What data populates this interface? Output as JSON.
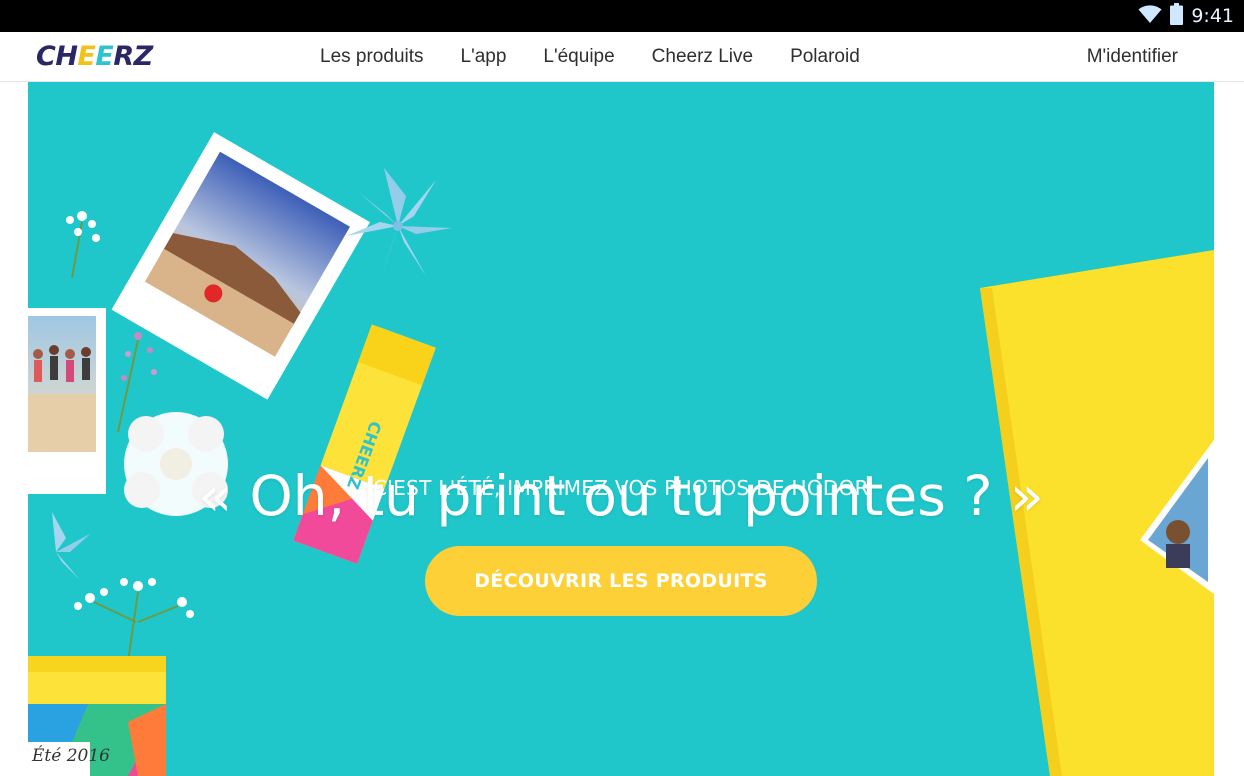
{
  "status_bar": {
    "time": "9:41",
    "icons": [
      "wifi-icon",
      "battery-icon"
    ]
  },
  "nav": {
    "logo_parts": [
      "CH",
      "E",
      "E",
      "RZ"
    ],
    "links": [
      "Les produits",
      "L'app",
      "L'équipe",
      "Cheerz Live",
      "Polaroid"
    ],
    "login": "M'identifier"
  },
  "hero": {
    "headline": "« Oh, tu print ou tu pointes ? »",
    "subline": "C'EST L'ÉTÉ, IMPRIMEZ VOS PHOTOS DE HODOR",
    "cta": "DÉCOUVRIR LES PRODUITS",
    "box_label": "Été 2016",
    "colors": {
      "background": "#1fc7cb",
      "cta": "#fdd038",
      "brand_navy": "#2a2765"
    }
  }
}
